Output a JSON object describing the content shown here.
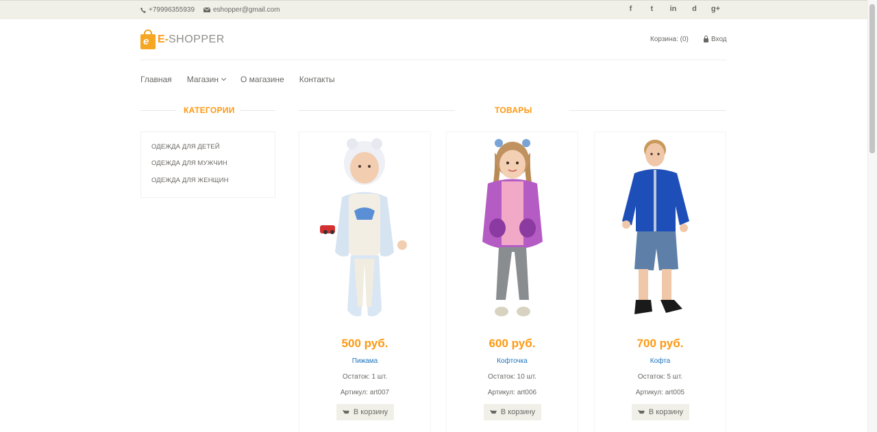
{
  "topbar": {
    "phone": "+79996355939",
    "email": "eshopper@gmail.com",
    "social": [
      "f",
      "t",
      "in",
      "d",
      "g+"
    ]
  },
  "header": {
    "logo_letter": "e",
    "logo_e": "E-",
    "logo_rest": "SHOPPER",
    "cart": "Корзина: (0)",
    "login": "Вход"
  },
  "nav": {
    "items": [
      "Главная",
      "Магазин",
      "О магазине",
      "Контакты"
    ]
  },
  "sections": {
    "categories_title": "Категории",
    "products_title": "Товары"
  },
  "categories": [
    "Одежда для детей",
    "Одежда для мужчин",
    "Одежда для женщин"
  ],
  "products": [
    {
      "price": "500 руб.",
      "name": "Пижама",
      "stock": "Остаток: 1 шт.",
      "sku": "Артикул: art007",
      "button": "В корзину"
    },
    {
      "price": "600 руб.",
      "name": "Кофточка",
      "stock": "Остаток: 10 шт.",
      "sku": "Артикул: art006",
      "button": "В корзину"
    },
    {
      "price": "700 руб.",
      "name": "Кофта",
      "stock": "Остаток: 5 шт.",
      "sku": "Артикул: art005",
      "button": "В корзину"
    }
  ],
  "colors": {
    "accent": "#fe980f",
    "link": "#1e73be",
    "topbar_bg": "#f0f0e9",
    "text": "#696763"
  }
}
